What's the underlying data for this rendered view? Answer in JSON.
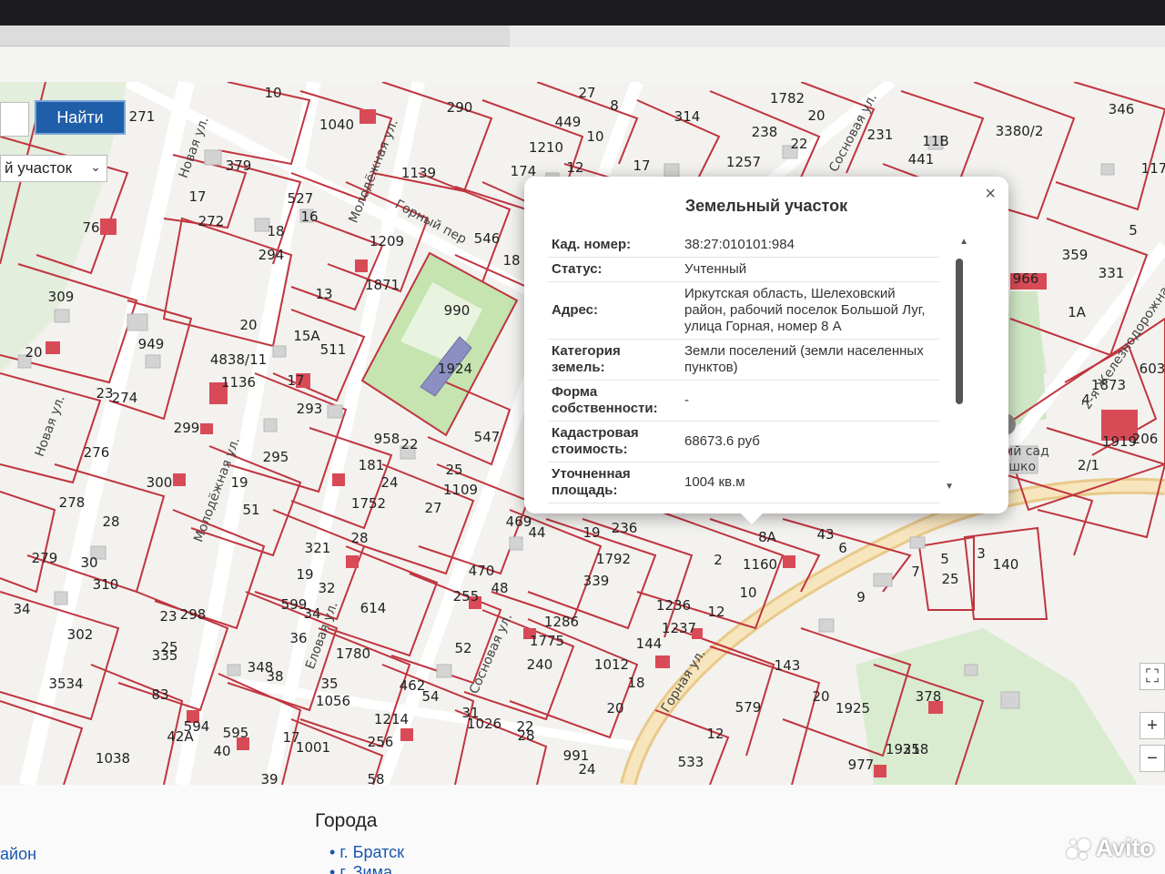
{
  "search": {
    "button_label": "Найти",
    "type_value": "й участок"
  },
  "popup": {
    "title": "Земельный участок",
    "close_symbol": "×",
    "rows": [
      {
        "key": "Кад. номер:",
        "value": "38:27:010101:984"
      },
      {
        "key": "Статус:",
        "value": "Учтенный"
      },
      {
        "key": "Адрес:",
        "value": "Иркутская область, Шелеховский район, рабочий поселок Большой Луг, улица Горная, номер 8 А"
      },
      {
        "key": "Категория земель:",
        "value": "Земли поселений (земли населенных пунктов)"
      },
      {
        "key": "Форма собственности:",
        "value": "-"
      },
      {
        "key": "Кадастровая стоимость:",
        "value": "68673.6 руб"
      },
      {
        "key": "Уточненная площадь:",
        "value": "1004 кв.м"
      }
    ]
  },
  "map": {
    "streets": [
      "Новая ул.",
      "Молодёжная ул.",
      "Горный пер",
      "Сосновая ул.",
      "Еловая ул.",
      "Горная ул.",
      "2-я Железнодорожная ул.",
      "Новая ул.",
      "Молодёжная ул.",
      "Сосновая ул."
    ],
    "plots": [
      "10",
      "1040",
      "290",
      "27",
      "8",
      "449",
      "10",
      "314",
      "1782",
      "20",
      "238",
      "22",
      "1257",
      "231",
      "11В",
      "441",
      "3380/2",
      "346",
      "117",
      "271",
      "379",
      "527",
      "16",
      "1139",
      "1210",
      "12",
      "174",
      "17",
      "76",
      "17",
      "272",
      "18",
      "294",
      "1209",
      "546",
      "18",
      "1871",
      "990",
      "309",
      "20",
      "949",
      "13",
      "15А",
      "511",
      "4838/11",
      "1136",
      "20",
      "1924",
      "23",
      "274",
      "17",
      "293",
      "958",
      "22",
      "547",
      "299",
      "295",
      "181",
      "24",
      "25",
      "1109",
      "300",
      "1752",
      "276",
      "27",
      "469",
      "44",
      "278",
      "28",
      "19",
      "51",
      "321",
      "28",
      "19",
      "236",
      "43",
      "279",
      "30",
      "310",
      "19",
      "1792",
      "2",
      "1160",
      "10",
      "34",
      "298",
      "32",
      "599",
      "34",
      "470",
      "48",
      "339",
      "1286",
      "1236",
      "1237",
      "12",
      "302",
      "23",
      "335",
      "25",
      "36",
      "614",
      "255",
      "1775",
      "240",
      "144",
      "1012",
      "18",
      "35",
      "34",
      "83",
      "348",
      "38",
      "1780",
      "462",
      "54",
      "52",
      "143",
      "579",
      "1925",
      "12",
      "533",
      "1038",
      "594",
      "42А",
      "595",
      "1214",
      "256",
      "17",
      "1001",
      "1056",
      "1026",
      "28",
      "22",
      "991",
      "20",
      "358",
      "24",
      "20",
      "378",
      "1921",
      "977",
      "140",
      "25",
      "5",
      "3",
      "1873",
      "603",
      "1919",
      "206",
      "2/1",
      "4",
      "9",
      "6",
      "7",
      "8А",
      "40",
      "39",
      "58",
      "35",
      "31",
      "5",
      "359",
      "331",
      "966",
      "1А"
    ],
    "kindergarten_label": "ский сад\nнышко",
    "zoom_in": "+",
    "zoom_out": "−",
    "fullscreen_symbol": "⛶"
  },
  "bottom": {
    "cities_title": "Города",
    "city_1": "г. Братск",
    "city_2": "г. Зима",
    "left_link": "айон"
  },
  "watermark": "Avito",
  "colors": {
    "plot_border": "#c0353f",
    "building": "#cfcfcf",
    "highlight_building": "#d94a57",
    "green": "#c8e6b8",
    "road": "#e9c98a",
    "button_blue": "#1f5ea8"
  }
}
